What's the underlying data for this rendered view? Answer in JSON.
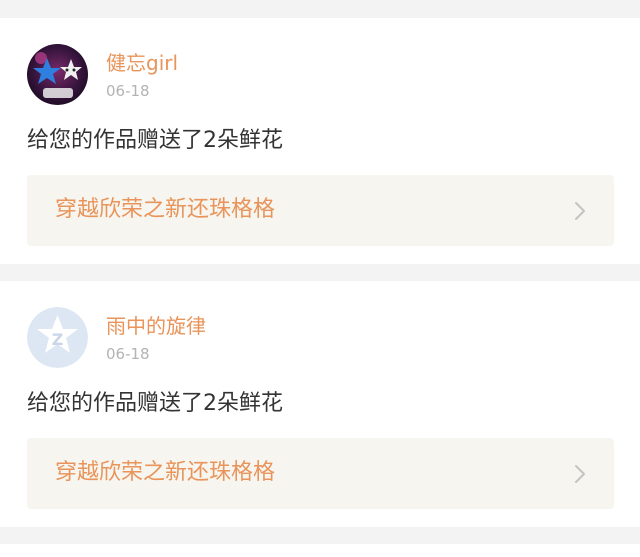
{
  "notifications": [
    {
      "username": "健忘girl",
      "date": "06-18",
      "message": "给您的作品赠送了2朵鲜花",
      "work_title": "穿越欣荣之新还珠格格",
      "avatar_icon": "stars-photo-avatar",
      "chevron_icon": "chevron-right-icon"
    },
    {
      "username": "雨中的旋律",
      "date": "06-18",
      "message": "给您的作品赠送了2朵鲜花",
      "work_title": "穿越欣荣之新还珠格格",
      "avatar_icon": "qq-default-avatar",
      "chevron_icon": "chevron-right-icon"
    }
  ],
  "colors": {
    "accent": "#e8945a",
    "date_gray": "#b3b3b3",
    "text": "#333333",
    "link_bg": "#f6f5ef",
    "page_bg": "#f3f3f3"
  }
}
